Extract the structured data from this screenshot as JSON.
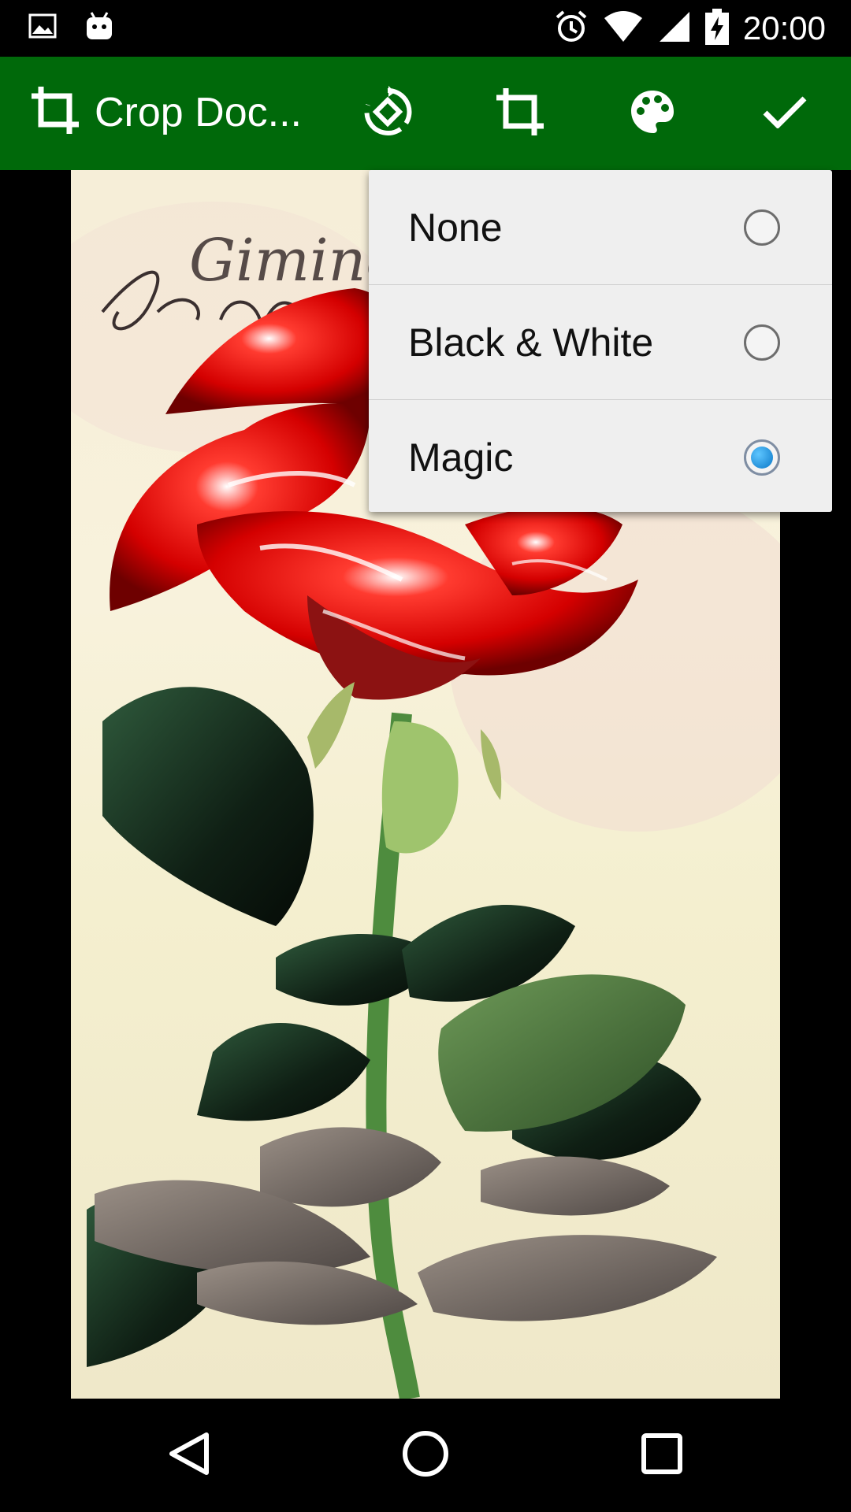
{
  "status_bar": {
    "time": "20:00",
    "left_icons": [
      "image-icon",
      "android-icon"
    ],
    "right_icons": [
      "alarm-icon",
      "wifi-icon",
      "signal-icon",
      "battery-charging-icon"
    ]
  },
  "toolbar": {
    "title": "Crop Doc...",
    "background": "#00690a",
    "actions": [
      "rotate-icon",
      "crop-icon",
      "palette-icon",
      "check-icon"
    ]
  },
  "filter_menu": {
    "options": [
      {
        "label": "None",
        "selected": false
      },
      {
        "label": "Black & White",
        "selected": false
      },
      {
        "label": "Magic",
        "selected": true
      }
    ],
    "selected_color": "#0a78c8"
  },
  "photo": {
    "handwriting": "Gimino"
  },
  "nav_bar": {
    "buttons": [
      "back-icon",
      "home-icon",
      "recents-icon"
    ]
  }
}
